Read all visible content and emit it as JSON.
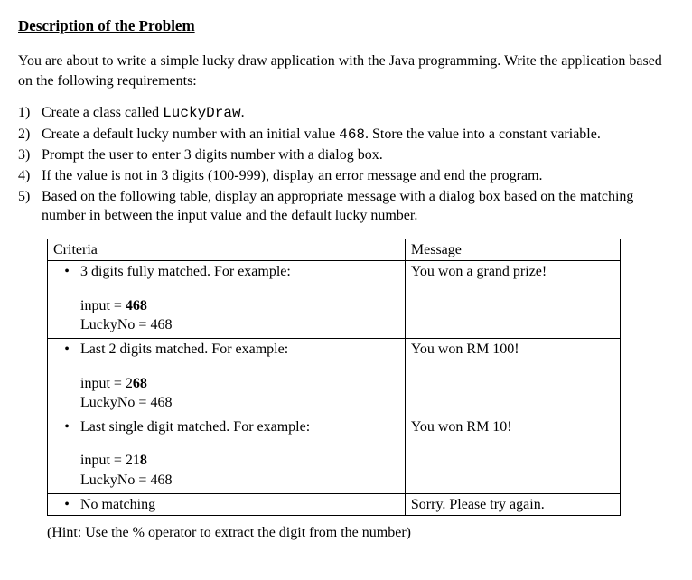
{
  "title": "Description of the Problem",
  "intro": "You are about to write a simple lucky draw application with the Java programming. Write the application based on the following requirements:",
  "requirements": [
    {
      "num": "1)",
      "text_pre": "Create a class called ",
      "code": "LuckyDraw",
      "text_post": "."
    },
    {
      "num": "2)",
      "text_pre": "Create a default lucky number with an initial value ",
      "code": "468",
      "text_post": ". Store the value into a constant variable."
    },
    {
      "num": "3)",
      "text_pre": "Prompt the user to enter 3 digits number with a dialog box.",
      "code": "",
      "text_post": ""
    },
    {
      "num": "4)",
      "text_pre": "If the value is not in 3 digits (100-999), display an error message and end the program.",
      "code": "",
      "text_post": ""
    },
    {
      "num": "5)",
      "text_pre": "Based on the following table, display an appropriate message with a dialog box based on the matching number in between the input value and the default lucky number.",
      "code": "",
      "text_post": ""
    }
  ],
  "table_header": {
    "criteria": "Criteria",
    "message": "Message"
  },
  "table_rows": [
    {
      "bullet_text": "3 digits fully matched. For example:",
      "input_label": "input = ",
      "input_plain": "",
      "input_bold": "468",
      "lucky_label": "LuckyNo = 468",
      "message": "You won a grand prize!"
    },
    {
      "bullet_text": "Last 2 digits matched. For example:",
      "input_label": "input = ",
      "input_plain": "2",
      "input_bold": "68",
      "lucky_label": "LuckyNo = 468",
      "message": "You won RM 100!"
    },
    {
      "bullet_text": "Last single digit matched. For example:",
      "input_label": "input = ",
      "input_plain": "21",
      "input_bold": "8",
      "lucky_label": "LuckyNo = 468",
      "message": "You won RM 10!"
    },
    {
      "bullet_text": "No matching",
      "input_label": "",
      "input_plain": "",
      "input_bold": "",
      "lucky_label": "",
      "message": "Sorry. Please try again."
    }
  ],
  "hint": "(Hint: Use the % operator to extract the digit from the number)"
}
